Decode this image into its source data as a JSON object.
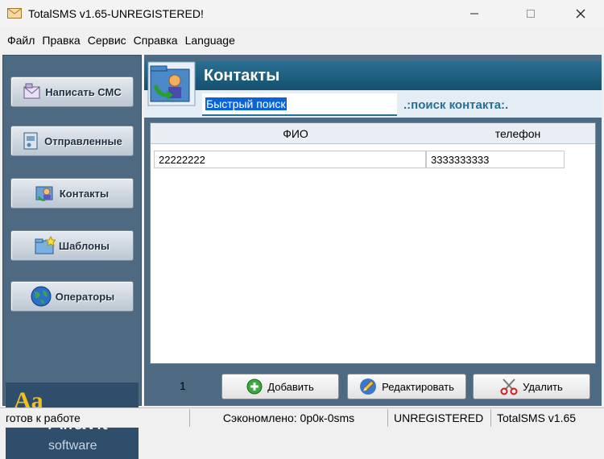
{
  "window": {
    "title": "TotalSMS v1.65-UNREGISTERED!"
  },
  "menu": [
    "Файл",
    "Правка",
    "Сервис",
    "Справка",
    "Language"
  ],
  "sidebar": {
    "items": [
      {
        "label": "Написать СМС",
        "icon": "sms-write-icon"
      },
      {
        "label": "Отправленные",
        "icon": "sent-icon"
      },
      {
        "label": "Контакты",
        "icon": "contacts-icon"
      },
      {
        "label": "Шаблоны",
        "icon": "templates-icon"
      },
      {
        "label": "Операторы",
        "icon": "globe-icon"
      }
    ],
    "logo": {
      "mark": "Aa",
      "name": "Alfavit",
      "sub": "software"
    }
  },
  "main": {
    "title": "Контакты",
    "search": {
      "value": "Быстрый поиск",
      "hint": ".:поиск контакта:."
    },
    "table": {
      "columns": [
        "ФИО",
        "телефон"
      ],
      "rows": [
        {
          "name": "22222222",
          "phone": "3333333333"
        }
      ]
    },
    "count": "1",
    "buttons": {
      "add": "Добавить",
      "edit": "Редактировать",
      "delete": "Удалить"
    }
  },
  "status": {
    "state": "готов к работе",
    "saved": "Сэкономлено: 0р0к-0sms",
    "license": "UNREGISTERED",
    "version": "TotalSMS v1.65"
  },
  "colors": {
    "accent": "#2b6f92",
    "panel": "#4e6a82",
    "highlight": "#0a64d8"
  }
}
